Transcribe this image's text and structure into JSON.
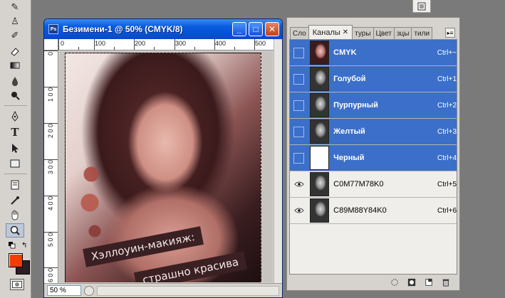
{
  "toolbox": {
    "tools": [
      {
        "name": "brush",
        "glyph": "✎"
      },
      {
        "name": "clone-stamp",
        "glyph": "♙"
      },
      {
        "name": "history-brush",
        "glyph": "✐"
      },
      {
        "name": "eraser",
        "glyph": "◇"
      },
      {
        "name": "gradient",
        "glyph": "▬"
      },
      {
        "name": "blur",
        "glyph": "💧"
      },
      {
        "name": "dodge",
        "glyph": "●"
      },
      {
        "name": "pen",
        "glyph": "✒"
      },
      {
        "name": "type",
        "glyph": "T"
      },
      {
        "name": "path-selection",
        "glyph": "➤"
      },
      {
        "name": "rectangle",
        "glyph": "▭"
      },
      {
        "name": "notes",
        "glyph": "▤"
      },
      {
        "name": "eyedropper",
        "glyph": "⟋"
      },
      {
        "name": "hand",
        "glyph": "✋"
      },
      {
        "name": "zoom",
        "glyph": "🔍"
      }
    ],
    "foreground_color": "#f23c00",
    "background_color": "#2a1e22"
  },
  "document": {
    "title": "Безимени-1 @ 50% (CMYK/8)",
    "zoom": "50 %",
    "ruler_top": [
      "0",
      "100",
      "200",
      "300",
      "400",
      "500"
    ],
    "ruler_left": [
      "0",
      "1 0 0",
      "2 0 0",
      "3 0 0",
      "4 0 0",
      "5 0 0",
      "6 0 0"
    ],
    "caption_line1": "Хэллоуин-макияж:",
    "caption_line2": "страшно красива",
    "minimize": "_",
    "maximize": "□",
    "close": "✕"
  },
  "panel": {
    "tabs": [
      {
        "label": "Сло",
        "active": false
      },
      {
        "label": "Каналы",
        "active": true
      },
      {
        "label": "туры",
        "active": false
      },
      {
        "label": "Цвет",
        "active": false
      },
      {
        "label": "зцы",
        "active": false
      },
      {
        "label": "тили",
        "active": false
      }
    ],
    "tab_close": "✕",
    "channels": [
      {
        "name": "CMYK",
        "shortcut": "Ctrl+~",
        "selected": true,
        "visible": false,
        "thumb": "color"
      },
      {
        "name": "Голубой",
        "shortcut": "Ctrl+1",
        "selected": true,
        "visible": false,
        "thumb": "gray"
      },
      {
        "name": "Пурпурный",
        "shortcut": "Ctrl+2",
        "selected": true,
        "visible": false,
        "thumb": "gray"
      },
      {
        "name": "Желтый",
        "shortcut": "Ctrl+3",
        "selected": true,
        "visible": false,
        "thumb": "gray"
      },
      {
        "name": "Черный",
        "shortcut": "Ctrl+4",
        "selected": true,
        "visible": false,
        "thumb": "white"
      },
      {
        "name": "C0M77M78K0",
        "shortcut": "Ctrl+5",
        "selected": false,
        "visible": true,
        "thumb": "gray"
      },
      {
        "name": "C89M88Y84K0",
        "shortcut": "Ctrl+6",
        "selected": false,
        "visible": true,
        "thumb": "gray"
      }
    ],
    "accent_color": "#3b6fc9"
  }
}
